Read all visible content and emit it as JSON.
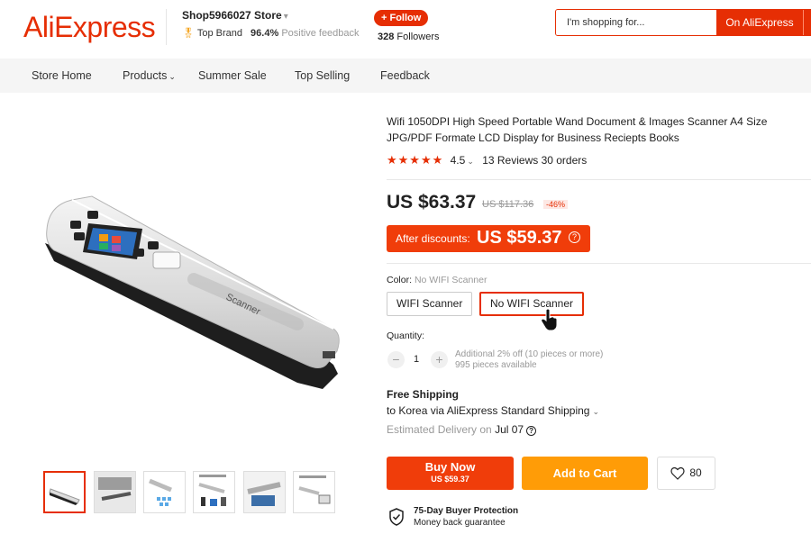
{
  "header": {
    "logo": "AliExpress",
    "store_name": "Shop5966027 Store",
    "badge": "Top Brand",
    "positive_pct": "96.4%",
    "positive_label": "Positive feedback",
    "follow_label": "+ Follow",
    "followers_count": "328",
    "followers_label": "Followers",
    "search_placeholder": "I'm shopping for...",
    "search_button": "On AliExpress"
  },
  "nav": {
    "items": [
      "Store Home",
      "Products",
      "Summer Sale",
      "Top Selling",
      "Feedback"
    ]
  },
  "product": {
    "title": "Wifi 1050DPI High Speed Portable Wand Document & Images Scanner A4 Size JPG/PDF Formate LCD Display for Business Reciepts Books",
    "rating": "4.5",
    "reviews": "13 Reviews",
    "orders": "30 orders",
    "price": "US $63.37",
    "original_price": "US $117.36",
    "discount": "-46%",
    "after_discount_label": "After discounts:",
    "after_discount_price": "US $59.37",
    "color_label": "Color:",
    "color_value": "No WIFI Scanner",
    "options": [
      "WIFI Scanner",
      "No WIFI Scanner"
    ],
    "selected_option": "No WIFI Scanner",
    "quantity_label": "Quantity:",
    "quantity": "1",
    "bulk_note": "Additional 2% off (10 pieces or more)",
    "stock_note": "995 pieces available",
    "image_text": "Scanner",
    "thumbnail_count": 6
  },
  "shipping": {
    "title": "Free Shipping",
    "route": "to Korea via AliExpress Standard Shipping",
    "delivery_label": "Estimated Delivery on",
    "delivery_date": "Jul 07"
  },
  "actions": {
    "buy_now": "Buy Now",
    "buy_now_price": "US $59.37",
    "add_to_cart": "Add to Cart",
    "wishlist_count": "80"
  },
  "protection": {
    "title": "75-Day Buyer Protection",
    "subtitle": "Money back guarantee"
  },
  "colors": {
    "brand_red": "#e62e04",
    "orange": "#ff9c07"
  }
}
